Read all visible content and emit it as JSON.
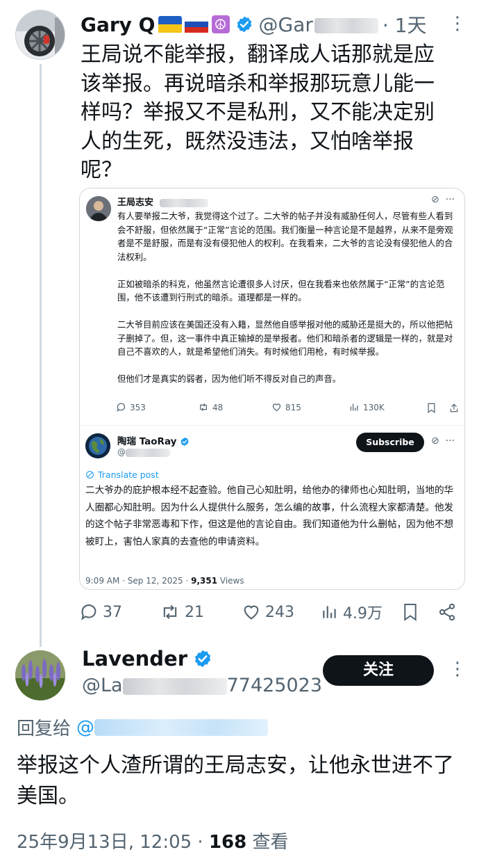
{
  "main_post": {
    "author_name": "Gary Q",
    "handle": "@Gar",
    "time": "· 1天",
    "text": "王局说不能举报，翻译成人话那就是应该举报。再说暗杀和举报那玩意儿能一样吗？举报又不是私刑，又不能决定别人的生死，既然没违法，又怕啥举报呢？",
    "stats": {
      "replies": "37",
      "reposts": "21",
      "likes": "243",
      "views": "4.9万"
    }
  },
  "quoted_screenshot": {
    "original": {
      "author_name": "王局志安",
      "paragraphs": [
        "有人要举报二大爷，我觉得这个过了。二大爷的帖子并没有威胁任何人，尽管有些人看到会不舒服，但依然属于“正常”言论的范围。我们衡量一种言论是不是越界，从来不是旁观者是不是舒服，而是有没有侵犯他人的权利。在我看来，二大爷的言论没有侵犯他人的合法权利。",
        "正如被暗杀的科克，他虽然言论遭很多人讨厌，但在我看来也依然属于“正常”的言论范围，他不该遭到行刑式的暗杀。道理都是一样的。",
        "二大爷目前应该在美国还没有入籍，显然他自感举报对他的威胁还是挺大的，所以他把帖子删掉了。但，这一事件中真正输掉的是举报者。他们和暗杀者的逻辑是一样的，就是对自己不喜欢的人，就是希望他们消失。有时候他们用枪，有时候举报。",
        "但他们才是真实的弱者，因为他们听不得反对自己的声音。"
      ],
      "stats": {
        "replies": "353",
        "reposts": "48",
        "likes": "815",
        "views": "130K"
      }
    },
    "reply": {
      "author_name": "陶瑞 TaoRay",
      "handle": "@",
      "subscribe_label": "Subscribe",
      "translate_label": "Translate post",
      "text": "二大爷办的庇护根本经不起查验。他自己心知肚明，给他办的律师也心知肚明，当地的华人圈都心知肚明。因为什么人提供什么服务，怎么编的故事，什么流程大家都清楚。他发的这个帖子非常恶毒和下作，但这是他的言论自由。我们知道他为什么删帖，因为他不想被盯上，害怕人家真的去查他的申请资料。",
      "timestamp": "9:09 AM · Sep 12, 2025 · ",
      "views_count": "9,351",
      "views_label": " Views"
    }
  },
  "reply_post": {
    "author_name": "Lavender",
    "handle_prefix": "@La",
    "handle_suffix": "77425023",
    "follow_label": "关注",
    "replying_to_label": "回复给",
    "replying_to_handle": "@",
    "text": "举报这个人渣所谓的王局志安，让他永世进不了美国。",
    "timestamp": "25年9月13日, 12:05 · ",
    "view_count": "168",
    "view_label": " 查看"
  },
  "colors": {
    "text_primary": "#0f1419",
    "text_secondary": "#536471",
    "accent_blue": "#1d9bf0",
    "verified_blue": "#1d9bf0",
    "border": "#cfd9de",
    "button_dark": "#0f1419"
  },
  "icons": [
    "reply-icon",
    "repost-icon",
    "like-icon",
    "views-icon",
    "bookmark-icon",
    "share-icon",
    "verified-badge-icon",
    "grok-icon",
    "more-icon",
    "translate-icon"
  ]
}
